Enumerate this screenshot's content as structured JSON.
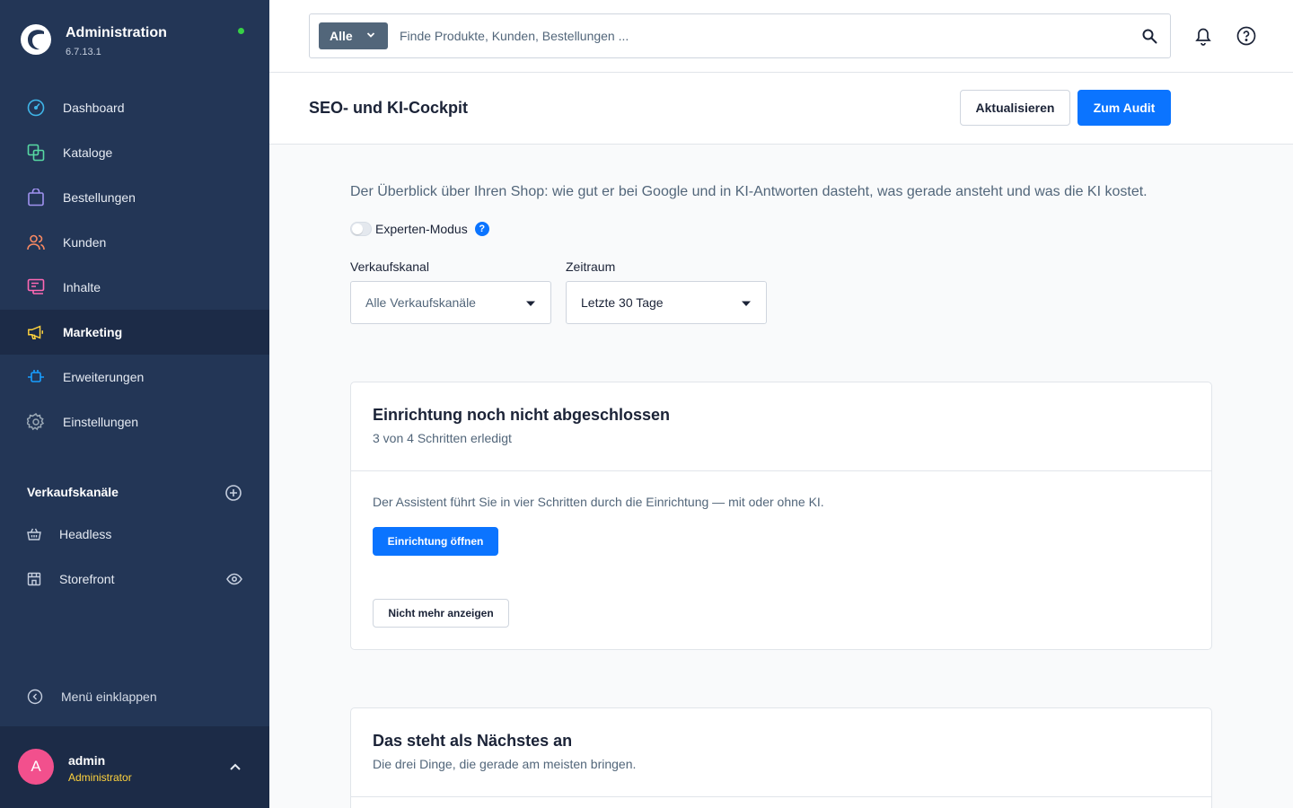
{
  "brand": {
    "title": "Administration",
    "version": "6.7.13.1",
    "status_color": "#37d046"
  },
  "sidebar": {
    "items": [
      {
        "label": "Dashboard",
        "icon": "dashboard-icon",
        "color": "#3fb5e8"
      },
      {
        "label": "Kataloge",
        "icon": "catalog-icon",
        "color": "#57d9a3"
      },
      {
        "label": "Bestellungen",
        "icon": "shopping-bag-icon",
        "color": "#a092f0"
      },
      {
        "label": "Kunden",
        "icon": "users-icon",
        "color": "#f88962"
      },
      {
        "label": "Inhalte",
        "icon": "content-icon",
        "color": "#ff68b4"
      },
      {
        "label": "Marketing",
        "icon": "megaphone-icon",
        "color": "#ffd33d",
        "active": true
      },
      {
        "label": "Erweiterungen",
        "icon": "plugin-icon",
        "color": "#189eff"
      },
      {
        "label": "Einstellungen",
        "icon": "gear-icon",
        "color": "#9aa8b5"
      }
    ],
    "sales_channels": {
      "title": "Verkaufskanäle",
      "items": [
        {
          "label": "Headless",
          "icon": "basket-icon"
        },
        {
          "label": "Storefront",
          "icon": "storefront-icon"
        }
      ]
    },
    "collapse_label": "Menü einklappen"
  },
  "user": {
    "initial": "A",
    "name": "admin",
    "role": "Administrator"
  },
  "search": {
    "type_label": "Alle",
    "placeholder": "Finde Produkte, Kunden, Bestellungen ..."
  },
  "smartbar": {
    "title": "SEO- und KI-Cockpit",
    "refresh_label": "Aktualisieren",
    "audit_label": "Zum Audit"
  },
  "content": {
    "intro": "Der Überblick über Ihren Shop: wie gut er bei Google und in KI-Antworten dasteht, was gerade ansteht und was die KI kostet.",
    "expert_mode": {
      "label": "Experten-Modus",
      "enabled": false,
      "help": "?"
    },
    "filters": {
      "channel": {
        "label": "Verkaufskanal",
        "value": "Alle Verkaufskanäle"
      },
      "period": {
        "label": "Zeitraum",
        "value": "Letzte 30 Tage"
      }
    },
    "setup_card": {
      "title": "Einrichtung noch nicht abgeschlossen",
      "subtitle": "3 von 4 Schritten erledigt",
      "text": "Der Assistent führt Sie in vier Schritten durch die Einrichtung — mit oder ohne KI.",
      "open_label": "Einrichtung öffnen",
      "dismiss_label": "Nicht mehr anzeigen"
    },
    "next_card": {
      "title": "Das steht als Nächstes an",
      "subtitle": "Die drei Dinge, die gerade am meisten bringen."
    }
  }
}
